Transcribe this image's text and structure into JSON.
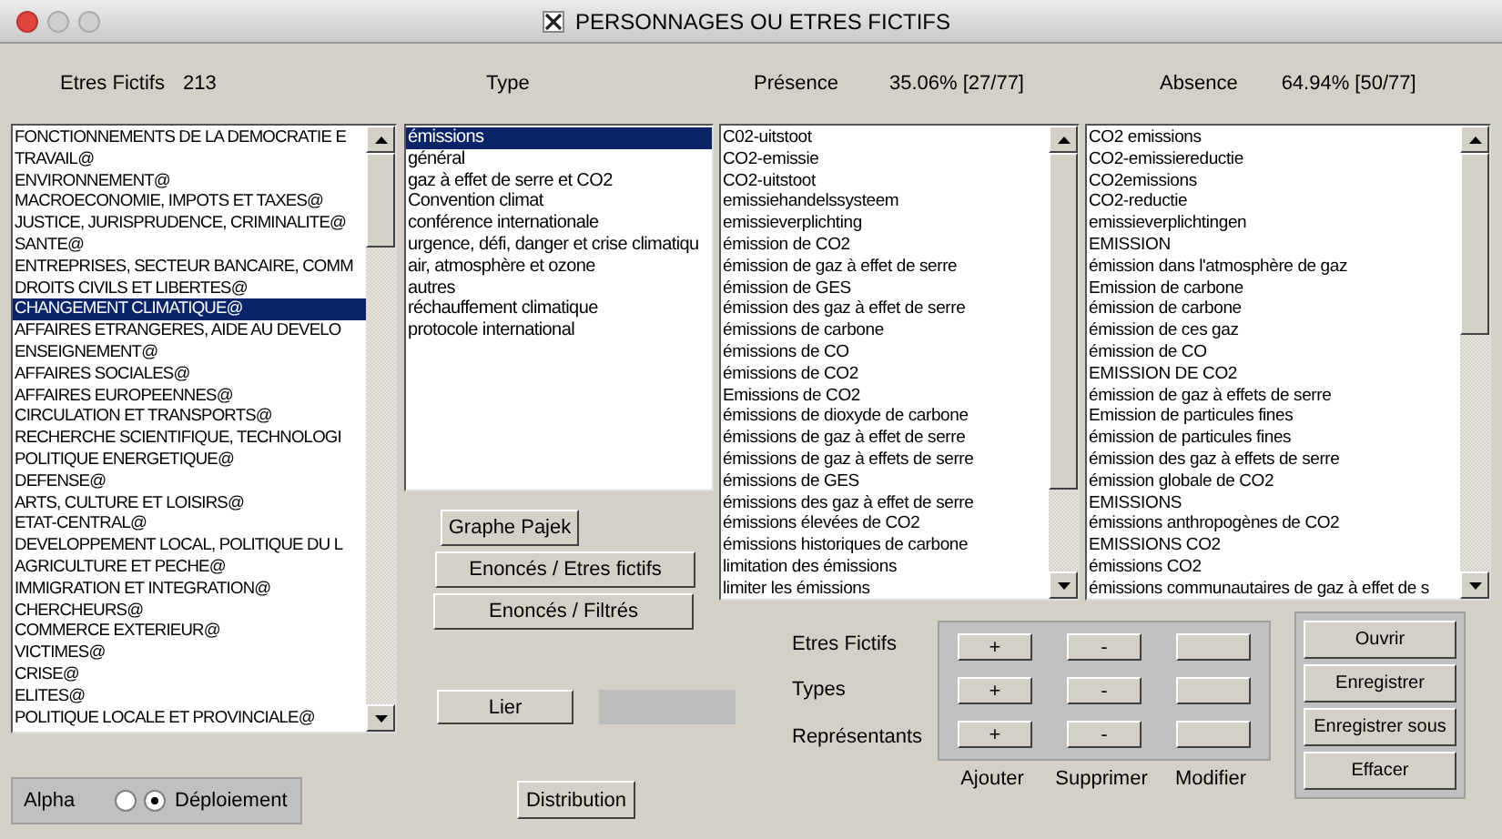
{
  "window": {
    "title": "PERSONNAGES OU ETRES FICTIFS"
  },
  "header": {
    "etres_label": "Etres Fictifs",
    "etres_count": "213",
    "type_label": "Type",
    "presence_label": "Présence",
    "presence_value": "35.06% [27/77]",
    "absence_label": "Absence",
    "absence_value": "64.94% [50/77]"
  },
  "etres_list": [
    {
      "label": "FONCTIONNEMENTS DE LA DEMOCRATIE E",
      "selected": false
    },
    {
      "label": "TRAVAIL@",
      "selected": false
    },
    {
      "label": "ENVIRONNEMENT@",
      "selected": false
    },
    {
      "label": "MACROECONOMIE, IMPOTS ET TAXES@",
      "selected": false
    },
    {
      "label": "JUSTICE, JURISPRUDENCE, CRIMINALITE@",
      "selected": false
    },
    {
      "label": "SANTE@",
      "selected": false
    },
    {
      "label": "ENTREPRISES, SECTEUR BANCAIRE, COMM",
      "selected": false
    },
    {
      "label": "DROITS CIVILS ET LIBERTES@",
      "selected": false
    },
    {
      "label": "CHANGEMENT CLIMATIQUE@",
      "selected": true
    },
    {
      "label": "AFFAIRES ETRANGERES, AIDE AU DEVELO",
      "selected": false
    },
    {
      "label": "ENSEIGNEMENT@",
      "selected": false
    },
    {
      "label": "AFFAIRES SOCIALES@",
      "selected": false
    },
    {
      "label": "AFFAIRES EUROPEENNES@",
      "selected": false
    },
    {
      "label": "CIRCULATION ET TRANSPORTS@",
      "selected": false
    },
    {
      "label": "RECHERCHE SCIENTIFIQUE, TECHNOLOGI",
      "selected": false
    },
    {
      "label": "POLITIQUE ENERGETIQUE@",
      "selected": false
    },
    {
      "label": "DEFENSE@",
      "selected": false
    },
    {
      "label": "ARTS, CULTURE ET LOISIRS@",
      "selected": false
    },
    {
      "label": "ETAT-CENTRAL@",
      "selected": false
    },
    {
      "label": "DEVELOPPEMENT LOCAL, POLITIQUE DU L",
      "selected": false
    },
    {
      "label": "AGRICULTURE ET PECHE@",
      "selected": false
    },
    {
      "label": "IMMIGRATION ET INTEGRATION@",
      "selected": false
    },
    {
      "label": "CHERCHEURS@",
      "selected": false
    },
    {
      "label": "COMMERCE EXTERIEUR@",
      "selected": false
    },
    {
      "label": "VICTIMES@",
      "selected": false
    },
    {
      "label": "CRISE@",
      "selected": false
    },
    {
      "label": "ELITES@",
      "selected": false
    },
    {
      "label": "POLITIQUE LOCALE ET PROVINCIALE@",
      "selected": false
    }
  ],
  "type_list": [
    {
      "label": "émissions",
      "selected": true
    },
    {
      "label": "général",
      "selected": false
    },
    {
      "label": "gaz à effet de serre et CO2",
      "selected": false
    },
    {
      "label": "Convention climat",
      "selected": false
    },
    {
      "label": "conférence internationale",
      "selected": false
    },
    {
      "label": "urgence, défi, danger et crise climatiqu",
      "selected": false
    },
    {
      "label": "air, atmosphère et ozone",
      "selected": false
    },
    {
      "label": "autres",
      "selected": false
    },
    {
      "label": "réchauffement climatique",
      "selected": false
    },
    {
      "label": "protocole international",
      "selected": false
    }
  ],
  "presence_list": [
    "C02-uitstoot",
    "CO2-emissie",
    "CO2-uitstoot",
    "emissiehandelssysteem",
    "emissieverplichting",
    "émission de CO2",
    "émission de gaz à effet de serre",
    "émission de GES",
    "émission des gaz à effet de serre",
    "émissions de carbone",
    "émissions de CO",
    "émissions de CO2",
    "Emissions de CO2",
    "émissions de dioxyde de carbone",
    "émissions de gaz à effet de serre",
    "émissions de gaz à effets de serre",
    "émissions de GES",
    "émissions des gaz à effet de serre",
    "émissions élevées de CO2",
    "émissions historiques de carbone",
    "limitation des émissions",
    "limiter les émissions"
  ],
  "absence_list": [
    "CO2 emissions",
    "CO2-emissiereductie",
    "CO2emissions",
    "CO2-reductie",
    "emissieverplichtingen",
    "EMISSION",
    "émission dans l'atmosphère de gaz",
    "Emission de carbone",
    "émission de carbone",
    "émission de ces gaz",
    "émission de CO",
    "EMISSION DE CO2",
    "émission de gaz à effets de serre",
    "Emission de particules fines",
    "émission de particules fines",
    "émission des gaz à effets de serre",
    "émission globale de CO2",
    "EMISSIONS",
    "émissions anthropogènes de CO2",
    "EMISSIONS CO2",
    "émissions CO2",
    "émissions communautaires de gaz à effet de s"
  ],
  "type_buttons": [
    "Graphe Pajek",
    "Enoncés / Etres fictifs",
    "Enoncés / Filtrés"
  ],
  "link_button": "Lier",
  "sort_options": {
    "label": "Alpha",
    "options": [
      {
        "selected": false
      },
      {
        "label": "Déploiement",
        "selected": true
      }
    ]
  },
  "distribution_button": "Distribution",
  "edit_rows": [
    {
      "label": "Etres Fictifs",
      "add": "+",
      "remove": "-"
    },
    {
      "label": "Types",
      "add": "+",
      "remove": "-"
    },
    {
      "label": "Représentants",
      "add": "+",
      "remove": "-"
    }
  ],
  "edit_columns": [
    "Ajouter",
    "Supprimer",
    "Modifier"
  ],
  "file_buttons": [
    "Ouvrir",
    "Enregistrer",
    "Enregistrer sous",
    "Effacer"
  ]
}
